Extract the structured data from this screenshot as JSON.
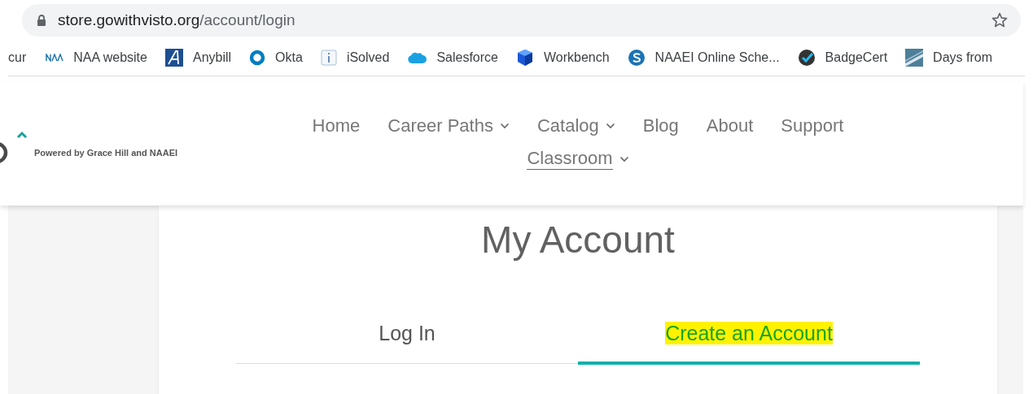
{
  "address_bar": {
    "domain": "store.gowithvisto.org",
    "path": "/account/login"
  },
  "bookmarks": [
    {
      "label": "cur"
    },
    {
      "label": "NAA website"
    },
    {
      "label": "Anybill"
    },
    {
      "label": "Okta"
    },
    {
      "label": "iSolved"
    },
    {
      "label": "Salesforce"
    },
    {
      "label": "Workbench"
    },
    {
      "label": "NAAEI Online Sche..."
    },
    {
      "label": "BadgeCert"
    },
    {
      "label": "Days from"
    }
  ],
  "logo": {
    "tagline": "Powered by Grace Hill and NAAEI"
  },
  "nav": [
    {
      "label": "Home",
      "kind": "link",
      "selected": false
    },
    {
      "label": "Career Paths",
      "kind": "dropdown",
      "selected": false
    },
    {
      "label": "Catalog",
      "kind": "dropdown",
      "selected": false
    },
    {
      "label": "Blog",
      "kind": "link",
      "selected": false
    },
    {
      "label": "About",
      "kind": "link",
      "selected": false
    },
    {
      "label": "Support",
      "kind": "link",
      "selected": false
    },
    {
      "label": "Classroom",
      "kind": "dropdown",
      "selected": true
    }
  ],
  "title": "My Account",
  "tabs": [
    {
      "label": "Log In",
      "selected": false,
      "highlighted": false
    },
    {
      "label": "Create an Account",
      "selected": true,
      "highlighted": true
    }
  ]
}
